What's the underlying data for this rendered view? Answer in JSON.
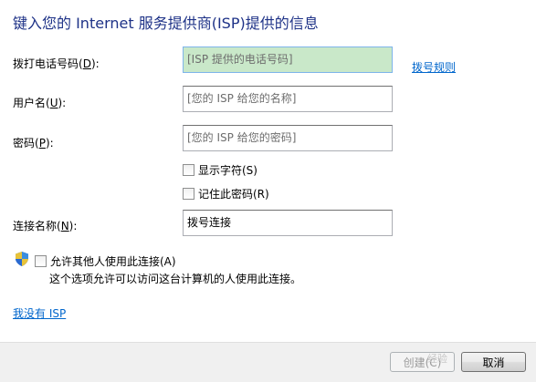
{
  "heading": "键入您的 Internet 服务提供商(ISP)提供的信息",
  "fields": {
    "phone": {
      "label_pre": "拨打电话号码(",
      "label_key": "D",
      "label_post": "):",
      "value": "[ISP 提供的电话号码]"
    },
    "username": {
      "label_pre": "用户名(",
      "label_key": "U",
      "label_post": "):",
      "value": "[您的 ISP 给您的名称]"
    },
    "password": {
      "label_pre": "密码(",
      "label_key": "P",
      "label_post": "):",
      "value": "[您的 ISP 给您的密码]"
    },
    "connection_name": {
      "label_pre": "连接名称(",
      "label_key": "N",
      "label_post": "):",
      "value": "拨号连接"
    }
  },
  "dialing_rules_link": "拨号规则",
  "checkboxes": {
    "show_chars": "显示字符(S)",
    "remember_password": "记住此密码(R)",
    "allow_others": "允许其他人使用此连接(A)"
  },
  "allow_others_description": "这个选项允许可以访问这台计算机的人使用此连接。",
  "no_isp_link": "我没有 ISP",
  "buttons": {
    "create": "创建(C)",
    "cancel": "取消"
  },
  "watermark": "经验",
  "colors": {
    "heading": "#1e3287",
    "link": "#0066cc",
    "focused_field": "#c9e8c9",
    "footer": "#f0f0f0"
  }
}
